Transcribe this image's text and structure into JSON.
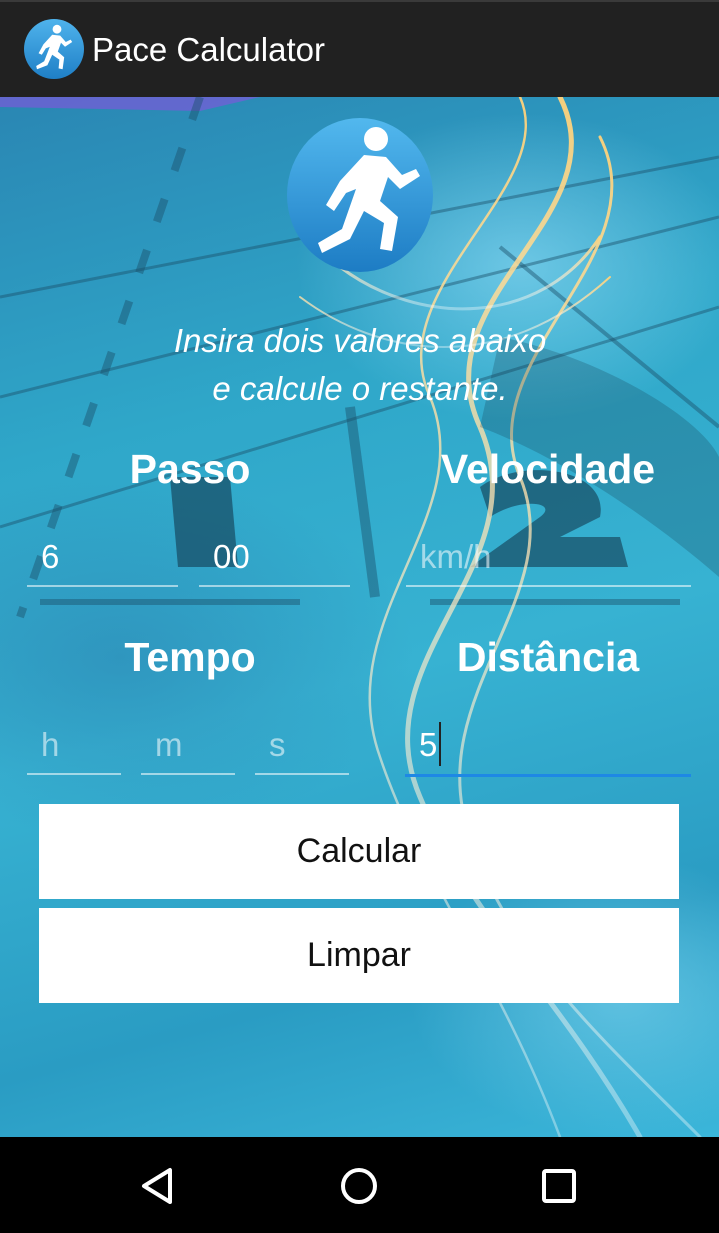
{
  "app": {
    "title": "Pace Calculator",
    "logo_icon": "runner-icon",
    "accent_color": "#1e88e5"
  },
  "main": {
    "instruction_line1": "Insira dois valores abaixo",
    "instruction_line2": "e calcule o restante.",
    "pace": {
      "label": "Passo",
      "minutes_value": "6",
      "seconds_value": "00"
    },
    "speed": {
      "label": "Velocidade",
      "placeholder": "km/h",
      "value": ""
    },
    "time": {
      "label": "Tempo",
      "hours_placeholder": "h",
      "minutes_placeholder": "m",
      "seconds_placeholder": "s"
    },
    "distance": {
      "label": "Distância",
      "value": "5"
    },
    "calculate_button": "Calcular",
    "clear_button": "Limpar"
  },
  "navbar": {
    "back_icon": "back-triangle-icon",
    "home_icon": "home-circle-icon",
    "recents_icon": "recents-square-icon"
  }
}
